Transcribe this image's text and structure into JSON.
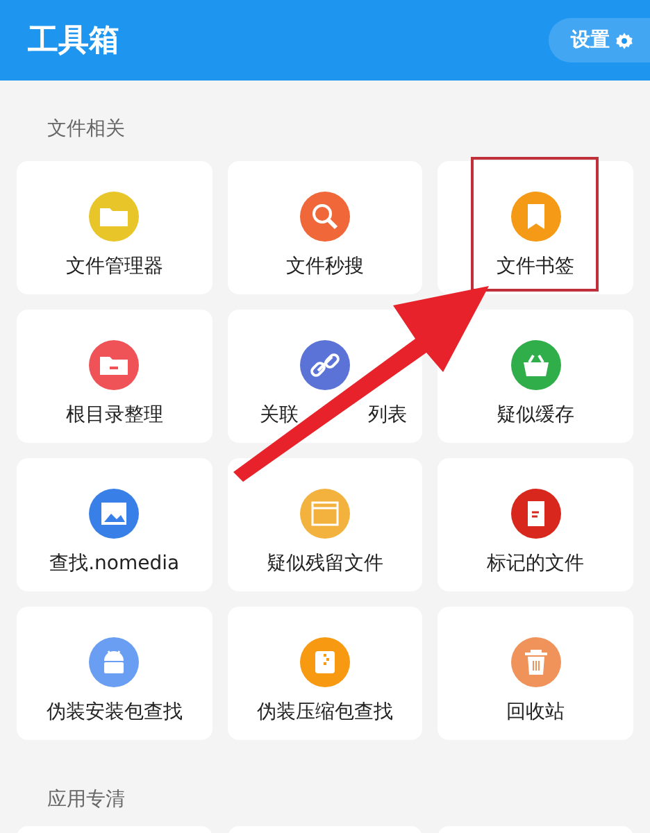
{
  "header": {
    "title": "工具箱",
    "settings_label": "设置"
  },
  "sections": [
    {
      "title": "文件相关",
      "tiles": [
        {
          "label": "文件管理器",
          "color": "#e8c62a"
        },
        {
          "label": "文件秒搜",
          "color": "#f0683a"
        },
        {
          "label": "文件书签",
          "color": "#f59a16",
          "highlighted": true
        },
        {
          "label": "根目录整理",
          "color": "#ef5358"
        },
        {
          "label_parts": [
            "关联",
            "列表"
          ],
          "color": "#5b72d6"
        },
        {
          "label": "疑似缓存",
          "color": "#2fae4a"
        },
        {
          "label": "查找.nomedia",
          "color": "#3880e8"
        },
        {
          "label": "疑似残留文件",
          "color": "#f3b23e"
        },
        {
          "label": "标记的文件",
          "color": "#d8281e"
        },
        {
          "label": "伪装安装包查找",
          "color": "#6a9ef2"
        },
        {
          "label": "伪装压缩包查找",
          "color": "#f79a12"
        },
        {
          "label": "回收站",
          "color": "#f0935a"
        }
      ]
    },
    {
      "title": "应用专清"
    }
  ],
  "annotation": {
    "arrow": true
  }
}
